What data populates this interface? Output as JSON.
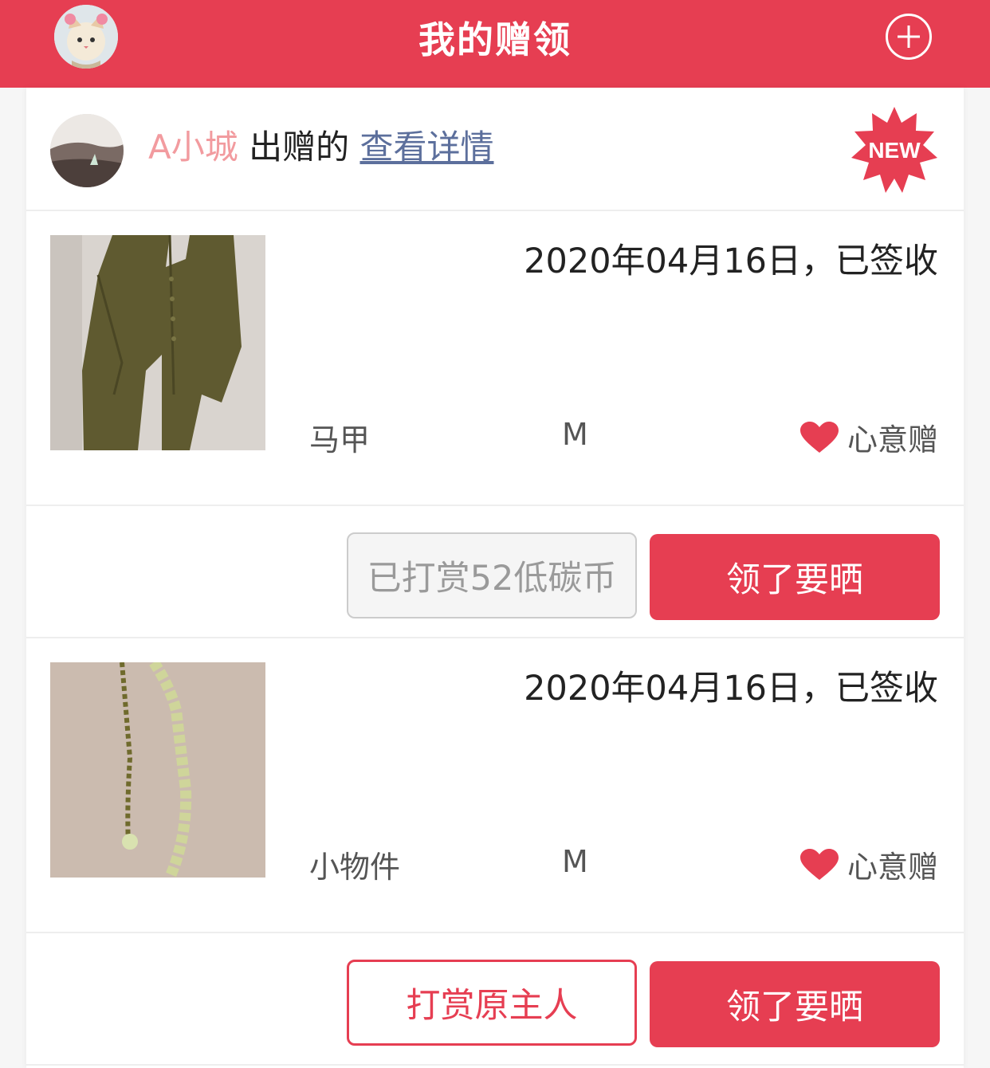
{
  "header": {
    "title": "我的赠领",
    "add_icon": "plus-circle-icon"
  },
  "giver": {
    "name": "A小城",
    "action": "出赠的",
    "link": "查看详情",
    "badge": "NEW"
  },
  "items": [
    {
      "date": "2020年04月16日，已签收",
      "name": "马甲",
      "size": "M",
      "gift_type": "心意赠",
      "left_button": "已打赏52低碳币",
      "right_button": "领了要晒"
    },
    {
      "date": "2020年04月16日，已签收",
      "name": "小物件",
      "size": "M",
      "gift_type": "心意赠",
      "left_button": "打赏原主人",
      "right_button": "领了要晒"
    }
  ],
  "colors": {
    "brand": "#e63e52",
    "giver_name": "#f29b9f",
    "link": "#5c6f9c"
  }
}
